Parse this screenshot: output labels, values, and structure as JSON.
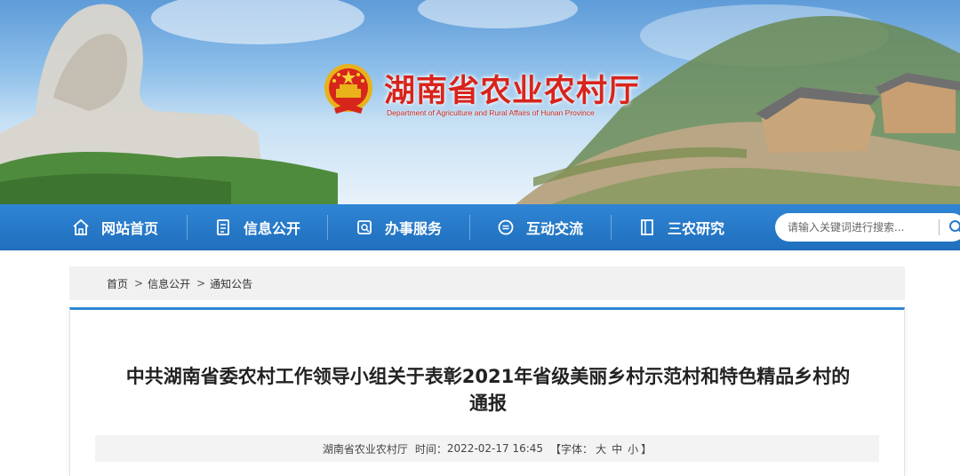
{
  "header": {
    "title": "湖南省农业农村厅",
    "subtitle": "Department of Agriculture and Rural Affairs of Hunan Province",
    "brand_color": "#d8241c"
  },
  "nav": {
    "items": [
      {
        "label": "网站首页",
        "icon": "home-icon"
      },
      {
        "label": "信息公开",
        "icon": "document-icon"
      },
      {
        "label": "办事服务",
        "icon": "service-icon"
      },
      {
        "label": "互动交流",
        "icon": "chat-icon"
      },
      {
        "label": "三农研究",
        "icon": "book-icon"
      }
    ],
    "bg_color": "#2a7cc9",
    "search_placeholder": "请输入关键词进行搜索..."
  },
  "breadcrumb": {
    "items": [
      "首页",
      "信息公开",
      "通知公告"
    ],
    "separator": ">"
  },
  "article": {
    "title_line1": "中共湖南省委农村工作领导小组关于表彰2021年省级美丽乡村示范村和特色精品乡村的",
    "title_line2": "通报",
    "source": "湖南省农业农村厅",
    "time_label": "时间：",
    "time": "2022-02-17 16:45",
    "font_size_open": "【字体：",
    "font_sizes": [
      "大",
      "中",
      "小"
    ],
    "font_size_close": "】"
  }
}
